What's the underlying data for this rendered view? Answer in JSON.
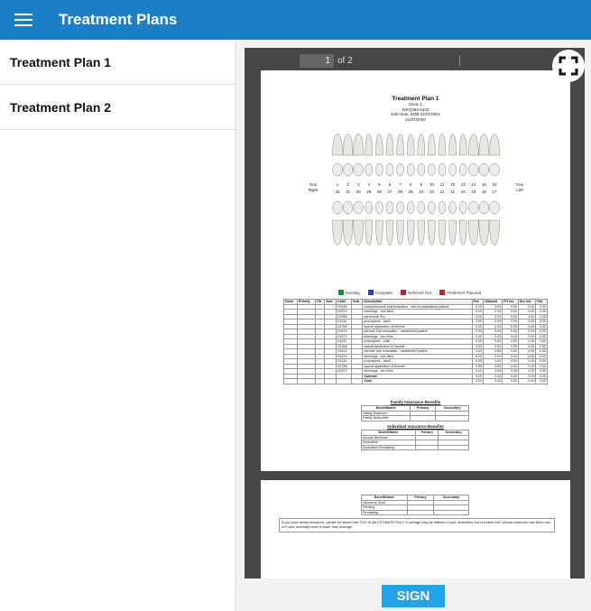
{
  "appbar": {
    "title": "Treatment Plans",
    "menu_icon": "hamburger-menu-icon"
  },
  "sidebar": {
    "items": [
      {
        "label": "Treatment Plan 1"
      },
      {
        "label": "Treatment Plan 2"
      }
    ]
  },
  "viewer": {
    "page_current": "1",
    "page_total_text": "of 2",
    "fullscreen_icon": "fullscreen-icon"
  },
  "document": {
    "title": "Treatment Plan 1",
    "clinic": "Clinic 1",
    "phone": "(503)363-5432",
    "patient": "John Doe, DOB 01/01/0001",
    "date": "01/07/2020",
    "your_right": [
      "Your",
      "Right"
    ],
    "your_left": [
      "Your",
      "Left"
    ],
    "upper_numbers": [
      "1",
      "2",
      "3",
      "4",
      "5",
      "6",
      "7",
      "8",
      "9",
      "10",
      "11",
      "12",
      "13",
      "14",
      "15",
      "16"
    ],
    "lower_numbers": [
      "32",
      "31",
      "30",
      "29",
      "28",
      "27",
      "26",
      "25",
      "24",
      "23",
      "22",
      "21",
      "20",
      "19",
      "18",
      "17"
    ],
    "legend": [
      {
        "label": "Existing",
        "color": "#1a8a2a"
      },
      {
        "label": "Complete",
        "color": "#2a3fb0"
      },
      {
        "label": "Referred Out",
        "color": "#c42020"
      },
      {
        "label": "Treatment Planned",
        "color": "#c42020"
      }
    ],
    "table_headers": [
      "Done",
      "Priority",
      "Tth",
      "Surf",
      "Code",
      "Sub",
      "Description",
      "Fee",
      "Allowed",
      "Pri Ins",
      "Sec Ins",
      "Pat"
    ],
    "rows": [
      [
        "",
        "",
        "",
        "",
        "D0150",
        "",
        "comprehensive oral evaluation - new or established patient",
        "0.00",
        "0.00",
        "0.00",
        "0.00",
        "0.00"
      ],
      [
        "",
        "",
        "",
        "",
        "D0274",
        "",
        "bitewings - four films",
        "0.00",
        "0.00",
        "0.00",
        "0.00",
        "0.00"
      ],
      [
        "",
        "",
        "",
        "",
        "D0330",
        "",
        "panoramic film",
        "0.00",
        "0.00",
        "0.00",
        "0.00",
        "0.00"
      ],
      [
        "",
        "",
        "",
        "",
        "D1110",
        "",
        "prophylaxis - adult",
        "0.00",
        "0.00",
        "0.00",
        "0.00",
        "0.00"
      ],
      [
        "",
        "",
        "",
        "",
        "D1208",
        "",
        "topical application of fluoride",
        "0.00",
        "0.00",
        "0.00",
        "0.00",
        "0.00"
      ],
      [
        "",
        "",
        "",
        "",
        "D0120",
        "",
        "periodic oral evaluation - established patient",
        "0.00",
        "0.00",
        "0.00",
        "0.00",
        "0.00"
      ],
      [
        "",
        "",
        "",
        "",
        "D0272",
        "",
        "bitewings - two films",
        "0.00",
        "0.00",
        "0.00",
        "0.00",
        "0.00"
      ],
      [
        "",
        "",
        "",
        "",
        "D1120",
        "",
        "prophylaxis - child",
        "0.00",
        "0.00",
        "0.00",
        "0.00",
        "0.00"
      ],
      [
        "",
        "",
        "",
        "",
        "D1208",
        "",
        "topical application of fluoride",
        "0.00",
        "0.00",
        "0.00",
        "0.00",
        "0.00"
      ],
      [
        "",
        "",
        "",
        "",
        "D0120",
        "",
        "periodic oral evaluation - established patient",
        "0.00",
        "0.00",
        "0.00",
        "0.00",
        "0.00"
      ],
      [
        "",
        "",
        "",
        "",
        "D0274",
        "",
        "bitewings - four films",
        "0.00",
        "0.00",
        "0.00",
        "0.00",
        "0.00"
      ],
      [
        "",
        "",
        "",
        "",
        "D1110",
        "",
        "prophylaxis - adult",
        "0.00",
        "0.00",
        "0.00",
        "0.00",
        "0.00"
      ],
      [
        "",
        "",
        "",
        "",
        "D1208",
        "",
        "topical application of fluoride",
        "0.00",
        "0.00",
        "0.00",
        "0.00",
        "0.00"
      ],
      [
        "",
        "",
        "",
        "",
        "D0272",
        "",
        "bitewings - two films",
        "0.00",
        "0.00",
        "0.00",
        "0.00",
        "0.00"
      ],
      [
        "",
        "",
        "",
        "",
        "",
        "",
        "Subtotal",
        "0.00",
        "0.00",
        "0.00",
        "0.00",
        "0.00"
      ],
      [
        "",
        "",
        "",
        "",
        "",
        "",
        "Total",
        "0.00",
        "0.00",
        "0.00",
        "0.00",
        "0.00"
      ]
    ],
    "family_title": "Family Insurance Benefits",
    "individual_title": "Individual Insurance Benefits",
    "benefit_headers": [
      "BenefitName",
      "Primary",
      "Secondary"
    ],
    "family_rows": [
      "Family Maximum",
      "Family Deductible"
    ],
    "individual_rows": [
      "Annual Maximum",
      "Deductible",
      "Deductible Remaining"
    ],
    "page2_rows": [
      "Insurance Used",
      "Pending",
      "Remaining"
    ],
    "disclaimer": "If you have dental insurance, please be aware that THIS IS AN ESTIMATE ONLY.  Coverage may be different if your deductible has not been met, annual maximum has been met, or if your coverage table is lower than average."
  },
  "sign_button": {
    "label": "SIGN"
  }
}
